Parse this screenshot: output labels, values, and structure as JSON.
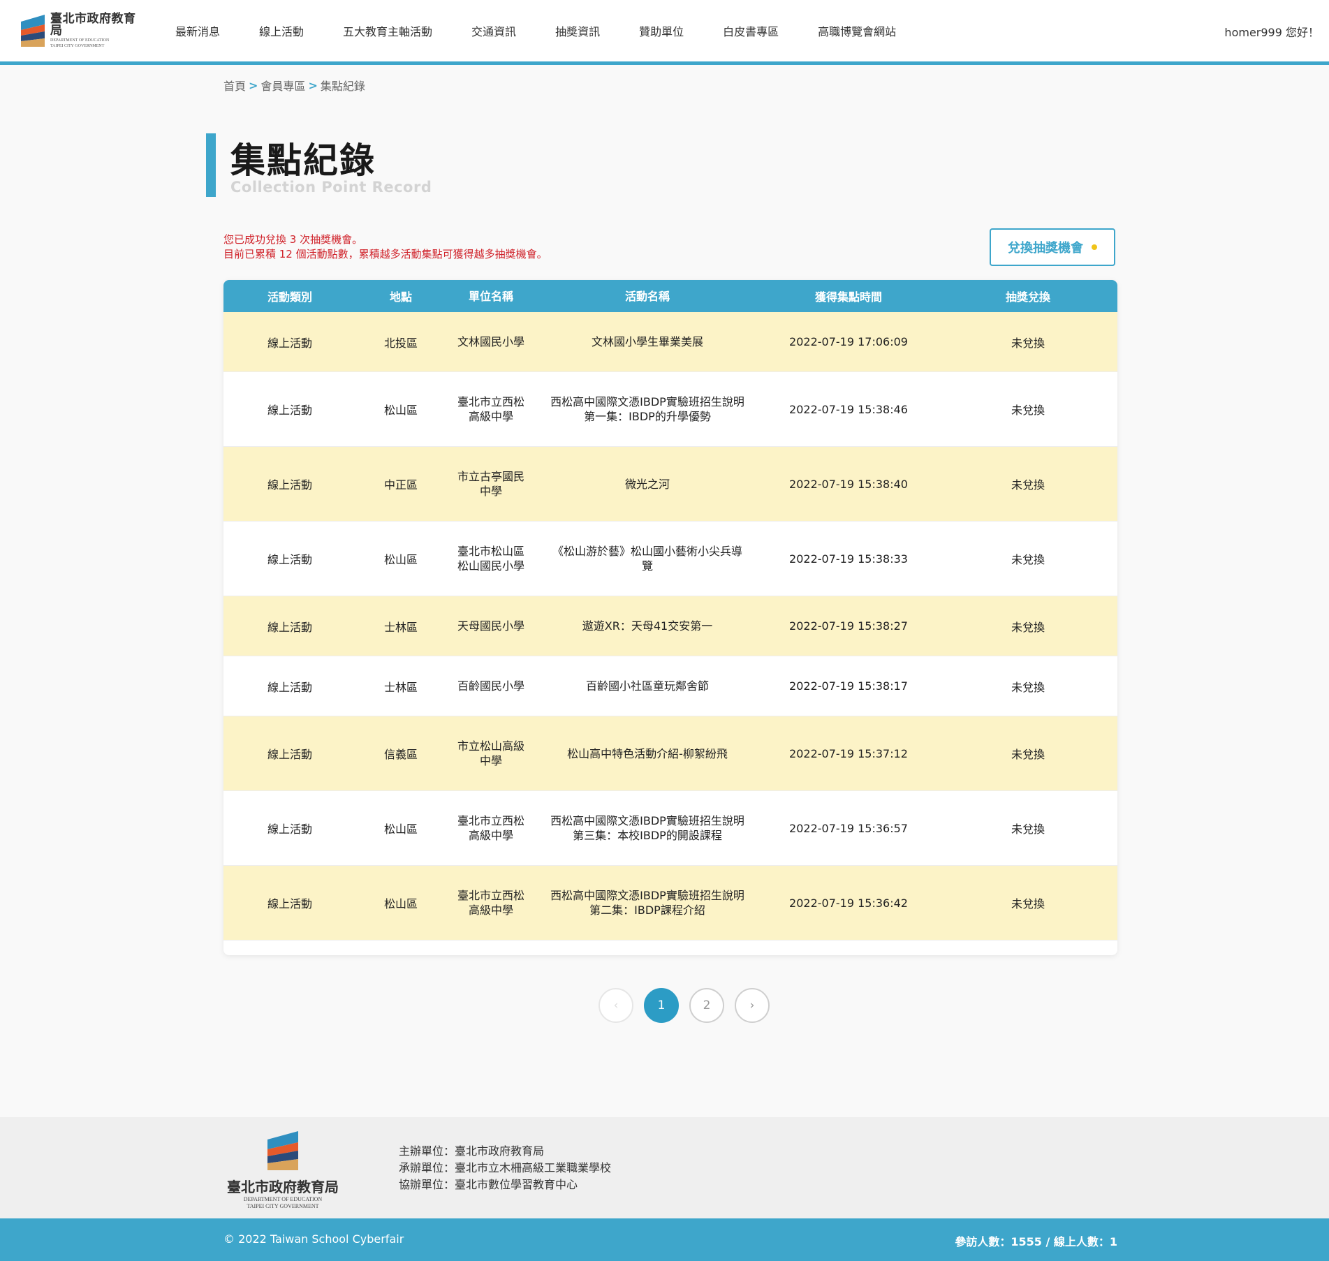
{
  "header": {
    "logo": {
      "zh": "臺北市政府教育局",
      "en1": "DEPARTMENT OF EDUCATION",
      "en2": "TAIPEI CITY GOVERNMENT"
    },
    "nav": [
      "最新消息",
      "線上活動",
      "五大教育主軸活動",
      "交通資訊",
      "抽獎資訊",
      "贊助單位",
      "白皮書專區",
      "高職博覽會網站"
    ],
    "user": "homer999 您好！"
  },
  "breadcrumb": [
    "首頁",
    "會員專區",
    "集點紀錄"
  ],
  "page": {
    "title_zh": "集點紀錄",
    "title_en": "Collection Point Record"
  },
  "notice": {
    "line1": "您已成功兌換 3 次抽獎機會。",
    "line2": "目前已累積 12 個活動點數，累積越多活動集點可獲得越多抽獎機會。"
  },
  "redeem_button": "兌換抽獎機會",
  "table": {
    "headers": [
      "活動類別",
      "地點",
      "單位名稱",
      "活動名稱",
      "獲得集點時間",
      "抽獎兌換"
    ],
    "rows": [
      {
        "category": "線上活動",
        "district": "北投區",
        "unit": [
          "文林國民小學"
        ],
        "activity": [
          "文林國小學生畢業美展"
        ],
        "time": "2022-07-19 17:06:09",
        "status": "未兌換"
      },
      {
        "category": "線上活動",
        "district": "松山區",
        "unit": [
          "臺北市立西松",
          "高級中學"
        ],
        "activity": [
          "西松高中國際文憑IBDP實驗班招生說明",
          "第一集：IBDP的升學優勢"
        ],
        "time": "2022-07-19 15:38:46",
        "status": "未兌換"
      },
      {
        "category": "線上活動",
        "district": "中正區",
        "unit": [
          "市立古亭國民",
          "中學"
        ],
        "activity": [
          "微光之河"
        ],
        "time": "2022-07-19 15:38:40",
        "status": "未兌換"
      },
      {
        "category": "線上活動",
        "district": "松山區",
        "unit": [
          "臺北市松山區",
          "松山國民小學"
        ],
        "activity": [
          "《松山游於藝》松山國小藝術小尖兵導",
          "覽"
        ],
        "time": "2022-07-19 15:38:33",
        "status": "未兌換"
      },
      {
        "category": "線上活動",
        "district": "士林區",
        "unit": [
          "天母國民小學"
        ],
        "activity": [
          "遨遊XR：天母41交安第一"
        ],
        "time": "2022-07-19 15:38:27",
        "status": "未兌換"
      },
      {
        "category": "線上活動",
        "district": "士林區",
        "unit": [
          "百齡國民小學"
        ],
        "activity": [
          "百齡國小社區童玩鄰舍節"
        ],
        "time": "2022-07-19 15:38:17",
        "status": "未兌換"
      },
      {
        "category": "線上活動",
        "district": "信義區",
        "unit": [
          "市立松山高級",
          "中學"
        ],
        "activity": [
          "松山高中特色活動介紹-柳絮紛飛"
        ],
        "time": "2022-07-19 15:37:12",
        "status": "未兌換"
      },
      {
        "category": "線上活動",
        "district": "松山區",
        "unit": [
          "臺北市立西松",
          "高級中學"
        ],
        "activity": [
          "西松高中國際文憑IBDP實驗班招生說明",
          "第三集：本校IBDP的開設課程"
        ],
        "time": "2022-07-19 15:36:57",
        "status": "未兌換"
      },
      {
        "category": "線上活動",
        "district": "松山區",
        "unit": [
          "臺北市立西松",
          "高級中學"
        ],
        "activity": [
          "西松高中國際文憑IBDP實驗班招生說明",
          "第二集：IBDP課程介紹"
        ],
        "time": "2022-07-19 15:36:42",
        "status": "未兌換"
      }
    ]
  },
  "pagination": {
    "prev": "‹",
    "pages": [
      "1",
      "2"
    ],
    "current": "1",
    "next": "›"
  },
  "footer": {
    "logo": {
      "zh": "臺北市政府教育局",
      "en1": "DEPARTMENT OF EDUCATION",
      "en2": "TAIPEI CITY GOVERNMENT"
    },
    "organizer": "主辦單位：臺北市政府教育局",
    "undertaker": "承辦單位：臺北市立木柵高級工業職業學校",
    "co_organizer": "協辦單位：臺北市數位學習教育中心",
    "copyright": "© 2022 Taiwan School Cyberfair",
    "visitors": "參訪人數：1555 / 線上人數：1"
  },
  "colors": {
    "accent": "#3ea6cb",
    "row_alt": "#fcf3c7",
    "notice": "#d0232b",
    "dot": "#f0c419"
  }
}
